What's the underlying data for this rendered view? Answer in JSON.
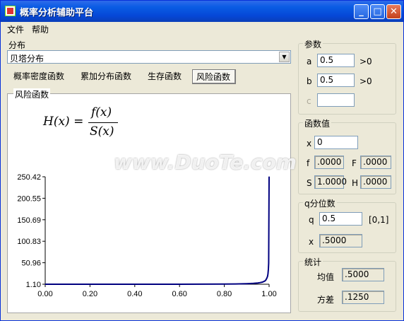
{
  "window": {
    "title": "概率分析辅助平台",
    "controls": {
      "minimize": "_",
      "maximize": "□",
      "close": "✕"
    }
  },
  "menu": [
    "文件",
    "帮助"
  ],
  "distribution": {
    "label": "分布",
    "selected": "贝塔分布"
  },
  "tabs": [
    "概率密度函数",
    "累加分布函数",
    "生存函数",
    "风险函数"
  ],
  "active_tab": "风险函数",
  "plot": {
    "group_title": "风险函数",
    "formula": {
      "lhs": "H(x) =",
      "numerator": "f(x)",
      "denominator": "S(x)"
    }
  },
  "params": {
    "title": "参数",
    "rows": [
      {
        "name": "a",
        "value": "0.5",
        "constraint": ">0"
      },
      {
        "name": "b",
        "value": "0.5",
        "constraint": ">0"
      },
      {
        "name": "c",
        "value": "",
        "constraint": ""
      }
    ]
  },
  "function_values": {
    "title": "函数值",
    "x_label": "x",
    "x_value": "0",
    "f_label": "f",
    "f_value": ".0000",
    "F_label": "F",
    "F_value": ".0000",
    "S_label": "S",
    "S_value": "1.0000",
    "H_label": "H",
    "H_value": ".0000"
  },
  "quantile": {
    "title": "q分位数",
    "q_label": "q",
    "q_value": "0.5",
    "q_range": "[0,1]",
    "x_label": "x",
    "x_value": ".5000"
  },
  "stats": {
    "title": "统计",
    "mean_label": "均值",
    "mean_value": ".5000",
    "var_label": "方差",
    "var_value": ".1250"
  },
  "watermark": "www.DuoTe.com",
  "chart_data": {
    "type": "line",
    "title": "",
    "xlabel": "",
    "ylabel": "",
    "xlim": [
      0,
      1
    ],
    "ylim": [
      1.1,
      250.42
    ],
    "x_ticks": [
      "0.00",
      "0.20",
      "0.40",
      "0.60",
      "0.80",
      "1.00"
    ],
    "y_ticks": [
      "1.10",
      "50.96",
      "100.83",
      "150.69",
      "200.55",
      "250.42"
    ],
    "grid": false,
    "color": "#000080",
    "series": [
      {
        "x": [
          0.0,
          0.02,
          0.05,
          0.1,
          0.2,
          0.3,
          0.4,
          0.5,
          0.6,
          0.7,
          0.8,
          0.85,
          0.9,
          0.93,
          0.95,
          0.96,
          0.97,
          0.98,
          0.985,
          0.99,
          0.993,
          0.995,
          0.997,
          0.998,
          1.0
        ],
        "values": [
          1.1,
          1.1,
          1.1,
          1.1,
          1.1,
          1.1,
          1.1,
          1.1,
          1.1,
          1.2,
          1.5,
          1.8,
          2.4,
          3.1,
          4.0,
          4.8,
          6.0,
          8.3,
          10.5,
          15.0,
          19.5,
          25.0,
          36.0,
          50.0,
          250.42
        ]
      }
    ]
  }
}
